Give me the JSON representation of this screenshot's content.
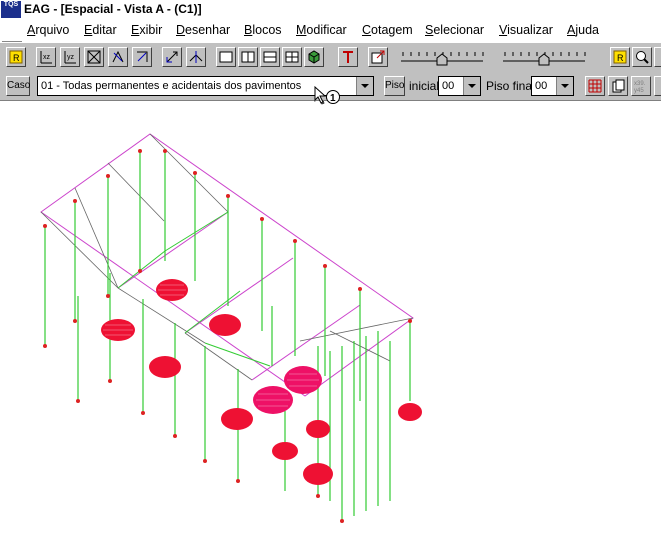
{
  "window": {
    "title": "EAG - [Espacial - Vista A -  (C1)]",
    "app_icon_text": "TQS"
  },
  "menu": [
    "Arquivo",
    "Editar",
    "Exibir",
    "Desenhar",
    "Blocos",
    "Modificar",
    "Cotagem",
    "Selecionar",
    "Visualizar",
    "Ajuda"
  ],
  "toolbar2": {
    "case_button": "Caso",
    "case_value": "01 - Todas permanentes e acidentais dos pavimentos",
    "floor_button": "Piso",
    "initial_label": "inicial",
    "initial_value": "00",
    "final_label": "Piso final",
    "final_value": "00"
  },
  "cursor_badge": "1",
  "colors": {
    "frame": "#cc44cc",
    "column": "#22cc22",
    "node": "#cc2222",
    "load": "#ee1133",
    "grid": "#666666"
  }
}
